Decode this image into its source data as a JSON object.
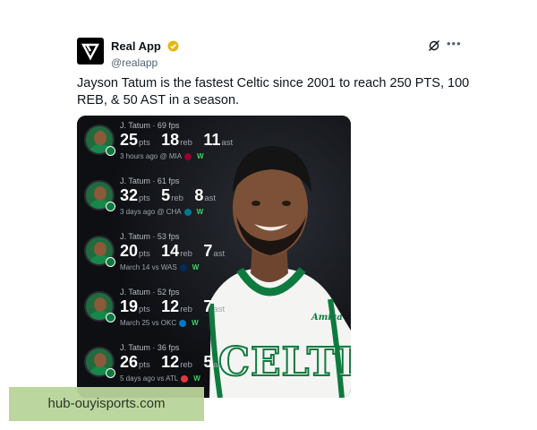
{
  "post": {
    "display_name": "Real App",
    "handle": "@realapp",
    "text": "Jayson Tatum is the fastest Celtic since 2001 to reach 250 PTS, 100 REB, & 50 AST in a season.",
    "icons": {
      "logo": "real-app-logo",
      "verified": "verified-badge-icon",
      "grok": "grok-icon",
      "more": "more-options-icon"
    },
    "colors": {
      "verified": "#e2b719",
      "win": "#3dd16b",
      "jersey_green": "#0e7a3e"
    }
  },
  "media": {
    "games": [
      {
        "title": "J. Tatum · 69 fps",
        "pts": "25",
        "reb": "18",
        "ast": "11",
        "meta": "3 hours ago @ MIA",
        "result": "W",
        "opp_color": "#98002e"
      },
      {
        "title": "J. Tatum · 61 fps",
        "pts": "32",
        "reb": "5",
        "ast": "8",
        "meta": "3 days ago @ CHA",
        "result": "W",
        "opp_color": "#00788c"
      },
      {
        "title": "J. Tatum · 53 fps",
        "pts": "20",
        "reb": "14",
        "ast": "7",
        "meta": "March 14 vs WAS",
        "result": "W",
        "opp_color": "#002b5c"
      },
      {
        "title": "J. Tatum · 52 fps",
        "pts": "19",
        "reb": "12",
        "ast": "7",
        "meta": "March 25 vs OKC",
        "result": "W",
        "opp_color": "#007ac1"
      },
      {
        "title": "J. Tatum · 36 fps",
        "pts": "26",
        "reb": "12",
        "ast": "5",
        "meta": "5 days ago vs ATL",
        "result": "W",
        "opp_color": "#e03a3e"
      }
    ],
    "units": {
      "pts": "pts",
      "reb": "reb",
      "ast": "ast"
    },
    "jersey_sponsor": "Amica",
    "jersey_text": "CELTICS"
  },
  "watermark": {
    "text": "hub-ouyisports.com"
  }
}
